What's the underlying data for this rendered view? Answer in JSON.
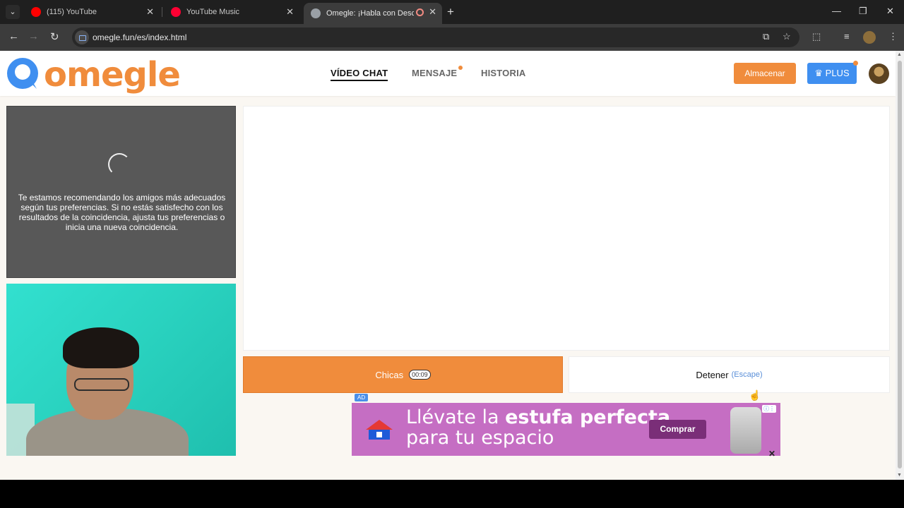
{
  "browser": {
    "tabs": [
      {
        "title": "(115) YouTube",
        "favicon": "youtube-icon",
        "active": false
      },
      {
        "title": "YouTube Music",
        "favicon": "youtube-music-icon",
        "active": false
      },
      {
        "title": "Omegle: ¡Habla con Descon",
        "favicon": "globe-icon",
        "active": true
      }
    ],
    "url": "omegle.fun/es/index.html"
  },
  "header": {
    "logo_text": "omegle",
    "nav": {
      "video_chat": "VÍDEO CHAT",
      "message": "MENSAJE",
      "history": "HISTORIA"
    },
    "store_button": "Almacenar",
    "plus_button": "PLUS"
  },
  "remote_video": {
    "message": "Te estamos recomendando los amigos más adecuados según tus preferencias. Si no estás satisfecho con los resultados de la coincidencia, ajusta tus preferencias o inicia una nueva coincidencia."
  },
  "controls": {
    "girls_button": "Chicas",
    "timer": "00:09",
    "stop_button": "Detener",
    "stop_shortcut": "(Escape)"
  },
  "ad": {
    "tag": "AD",
    "line1_normal": "Llévate la ",
    "line1_bold": "estufa perfecta",
    "line2": "para tu espacio",
    "cta": "Comprar",
    "close": "✕"
  },
  "colors": {
    "accent_orange": "#f08c3c",
    "plus_blue": "#3f8ff0",
    "ad_purple": "#c56ec3"
  }
}
